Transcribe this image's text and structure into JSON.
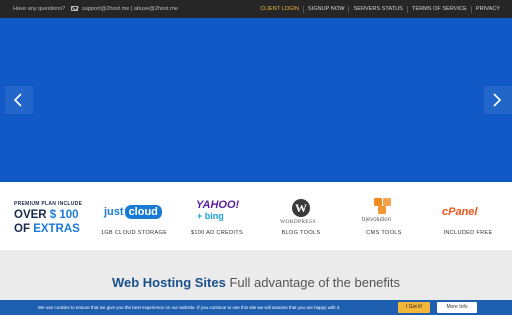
{
  "topbar": {
    "question": "Have any questions?",
    "emails": "support@2host.me | abuse@2host.me",
    "nav": [
      "CLIENT LOGIN",
      "SIGNUP NOW",
      "SERVERS STATUS",
      "TERMS OF SERVICE",
      "PRIVACY"
    ]
  },
  "colors": {
    "hero": "#1159c6",
    "accent": "#1a7bd6",
    "login": "#f2b63a"
  },
  "plan": {
    "label": "PREMIUM PLAN INCLUDE",
    "over": "OVER",
    "amount": "$ 100",
    "of": "OF",
    "extras": "EXTRAS"
  },
  "partners": [
    {
      "logo_a": "just",
      "logo_b": "cloud",
      "caption": "1GB CLOUD STORAGE"
    },
    {
      "logo_a": "YAHOO!",
      "logo_b": "+ bing",
      "caption": "$100 AD CREDITS"
    },
    {
      "logo_a": "W",
      "logo_b": "WORDPRESS",
      "caption": "BLOG TOOLS"
    },
    {
      "logo_a": "b|evolution",
      "caption": "CMS TOOLS"
    },
    {
      "logo_a": "cPanel",
      "caption": "INCLUDED FREE"
    }
  ],
  "section": {
    "heading_bold": "Web Hosting Sites",
    "heading_rest": " Full advantage of the benefits"
  },
  "cookie": {
    "message": "We use cookies to ensure that we give you the best experience on our website. If you continue to use this site we will assume that you are happy with it.",
    "ok": "I Got it!",
    "more": "More Info"
  }
}
